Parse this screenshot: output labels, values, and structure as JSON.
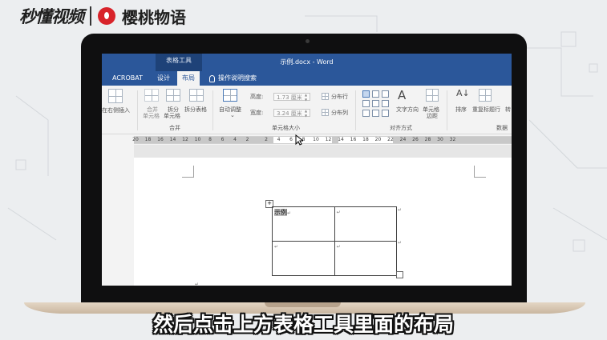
{
  "brand": {
    "logo_text": "秒懂视频",
    "partner_name": "樱桃物语"
  },
  "word": {
    "contextual_group": "表格工具",
    "doc_title": "示例.docx  -  Word",
    "tabs": [
      {
        "label": "ACROBAT"
      },
      {
        "label": "设计"
      },
      {
        "label": "布局"
      }
    ],
    "search_label": "操作说明搜索",
    "ribbon": {
      "insert_right": "在右侧插入",
      "merge_cells_1": "合并",
      "merge_cells_2": "单元格",
      "split_cells_1": "拆分",
      "split_cells_2": "单元格",
      "split_table": "拆分表格",
      "group_merge": "合并",
      "autofit": "自动调整",
      "height_label": "高度:",
      "height_value": "1.73 厘米",
      "width_label": "宽度:",
      "width_value": "3.24 厘米",
      "distribute_rows": "分布行",
      "distribute_cols": "分布列",
      "group_cell_size": "单元格大小",
      "text_direction": "文字方向",
      "cell_margins_1": "单元格",
      "cell_margins_2": "边距",
      "group_alignment": "对齐方式",
      "sort": "排序",
      "repeat_header": "重复标题行",
      "convert": "转",
      "group_data": "数据"
    },
    "ruler_ticks": [
      "20",
      "18",
      "16",
      "14",
      "12",
      "10",
      "8",
      "6",
      "4",
      "2",
      "2",
      "4",
      "6",
      "8",
      "10",
      "12",
      "14",
      "16",
      "18",
      "20",
      "22",
      "24",
      "26",
      "28",
      "30",
      "32"
    ],
    "table": {
      "cell_text": "示例",
      "para_mark": "↵"
    }
  },
  "subtitle": "然后点击上方表格工具里面的布局"
}
